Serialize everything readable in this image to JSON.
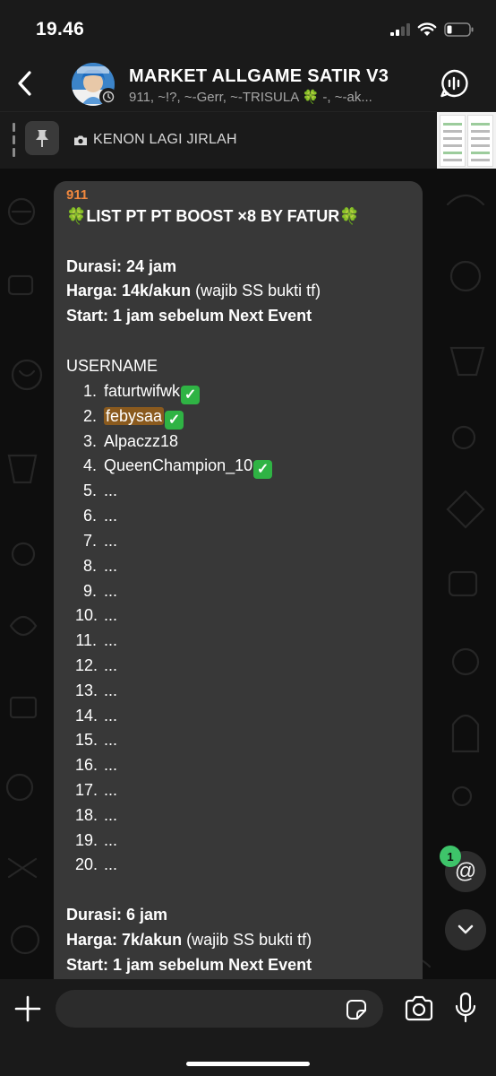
{
  "status_bar": {
    "time": "19.46"
  },
  "header": {
    "title": "MARKET ALLGAME SATIR V3",
    "members": "911, ~!?, ~-Gerr, ~-TRISULA 🍀 -, ~-ak..."
  },
  "pinned": {
    "text": "KENON LAGI JIRLAH"
  },
  "message": {
    "sender": "911",
    "title": "LIST PT PT BOOST ×8 BY FATUR",
    "clover": "🍀",
    "check": "✓",
    "section1": {
      "durasi_label": "Durasi:",
      "durasi_value": "24 jam",
      "harga_label": "Harga:",
      "harga_value": "14k/akun",
      "harga_note": "(wajib SS bukti tf)",
      "start_label": "Start:",
      "start_value": "1 jam sebelum Next Event"
    },
    "username_heading": "USERNAME",
    "usernames": [
      {
        "num": "1.",
        "name": "faturtwifwk",
        "checked": true,
        "highlight": false
      },
      {
        "num": "2.",
        "name": "febysaa",
        "checked": true,
        "highlight": true
      },
      {
        "num": "3.",
        "name": "Alpaczz18",
        "checked": false,
        "highlight": false
      },
      {
        "num": "4.",
        "name": "QueenChampion_10",
        "checked": true,
        "highlight": false
      },
      {
        "num": "5.",
        "name": "...",
        "checked": false,
        "highlight": false
      },
      {
        "num": "6.",
        "name": "...",
        "checked": false,
        "highlight": false
      },
      {
        "num": "7.",
        "name": "...",
        "checked": false,
        "highlight": false
      },
      {
        "num": "8.",
        "name": "...",
        "checked": false,
        "highlight": false
      },
      {
        "num": "9.",
        "name": "...",
        "checked": false,
        "highlight": false
      },
      {
        "num": "10.",
        "name": "...",
        "checked": false,
        "highlight": false
      },
      {
        "num": "11.",
        "name": "...",
        "checked": false,
        "highlight": false
      },
      {
        "num": "12.",
        "name": "...",
        "checked": false,
        "highlight": false
      },
      {
        "num": "13.",
        "name": "...",
        "checked": false,
        "highlight": false
      },
      {
        "num": "14.",
        "name": "...",
        "checked": false,
        "highlight": false
      },
      {
        "num": "15.",
        "name": "...",
        "checked": false,
        "highlight": false
      },
      {
        "num": "16.",
        "name": "...",
        "checked": false,
        "highlight": false
      },
      {
        "num": "17.",
        "name": "...",
        "checked": false,
        "highlight": false
      },
      {
        "num": "18.",
        "name": "...",
        "checked": false,
        "highlight": false
      },
      {
        "num": "19.",
        "name": "...",
        "checked": false,
        "highlight": false
      },
      {
        "num": "20.",
        "name": "...",
        "checked": false,
        "highlight": false
      }
    ],
    "section2": {
      "durasi_label": "Durasi:",
      "durasi_value": "6 jam",
      "harga_label": "Harga:",
      "harga_value": "7k/akun",
      "harga_note": "(wajib SS bukti tf)",
      "start_label": "Start:",
      "start_value": "1 jam sebelum Next Event"
    }
  },
  "mention": {
    "symbol": "@",
    "count": "1"
  },
  "composer": {
    "placeholder": ""
  },
  "colors": {
    "accent_green": "#3ec46a",
    "sender_orange": "#f0883e",
    "bubble": "#383838",
    "highlight": "#8a5a1e"
  }
}
